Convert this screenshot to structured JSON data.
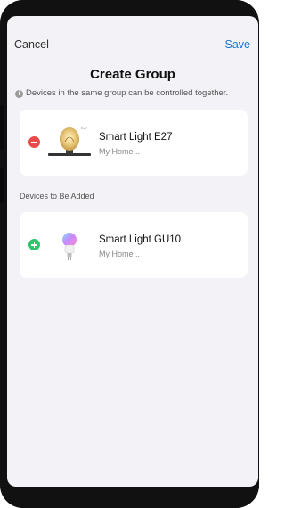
{
  "nav": {
    "cancel_label": "Cancel",
    "save_label": "Save"
  },
  "header": {
    "title": "Create Group",
    "info_text": "Devices in the same group can be controlled together."
  },
  "group_devices": [
    {
      "name": "Smart Light E27",
      "location": "My Home ..",
      "action": "remove",
      "icon": "edison-bulb-icon"
    }
  ],
  "section": {
    "label": "Devices to Be Added"
  },
  "available_devices": [
    {
      "name": "Smart Light GU10",
      "location": "My Home ..",
      "action": "add",
      "icon": "rgb-bulb-icon"
    }
  ],
  "colors": {
    "accent": "#1a73d9",
    "remove": "#e94b4b",
    "add": "#2fc56d",
    "background": "#f2f2f7"
  }
}
